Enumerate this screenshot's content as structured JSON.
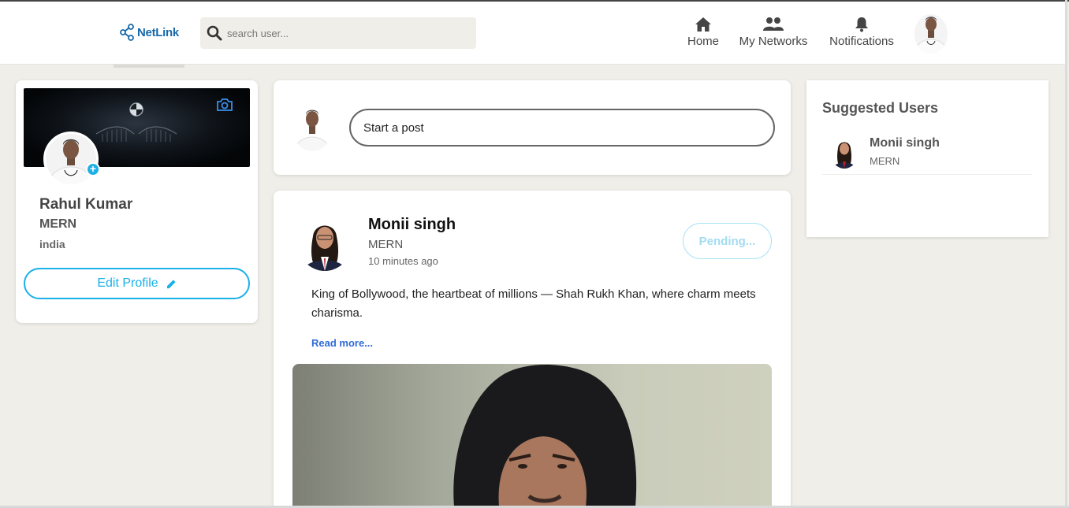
{
  "brand": {
    "name": "NetLink",
    "accent": "#1769aa"
  },
  "search": {
    "placeholder": "search user..."
  },
  "nav": {
    "home": "Home",
    "networks": "My Networks",
    "notifications": "Notifications"
  },
  "profile": {
    "name": "Rahul Kumar",
    "role": "MERN",
    "location": "india",
    "edit_label": "Edit Profile",
    "accent": "#1ab0e8"
  },
  "composer": {
    "placeholder": "Start a post"
  },
  "post": {
    "author": "Monii singh",
    "role": "MERN",
    "time": "10 minutes ago",
    "status_label": "Pending...",
    "text": "King of Bollywood, the heartbeat of millions — Shah Rukh Khan, where charm meets charisma.",
    "read_more": "Read more..."
  },
  "suggested": {
    "title": "Suggested Users",
    "users": [
      {
        "name": "Monii singh",
        "role": "MERN"
      }
    ]
  },
  "icons": {
    "logo": "share-nodes-icon",
    "search": "search-icon",
    "home": "home-icon",
    "networks": "users-icon",
    "notifications": "bell-icon",
    "camera": "camera-icon",
    "plus": "plus-icon",
    "edit": "pencil-icon"
  }
}
